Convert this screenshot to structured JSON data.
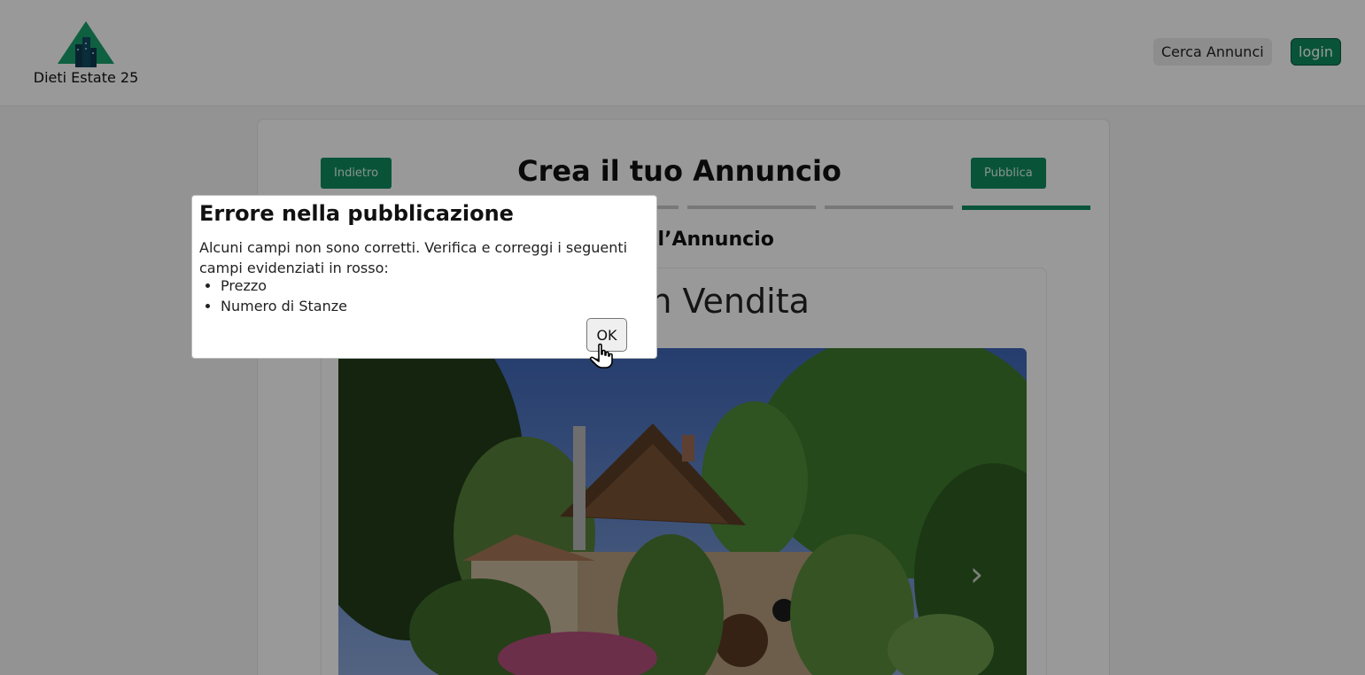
{
  "header": {
    "brand_name": "Dieti Estate 25",
    "logo_icon": "pyramid-buildings-logo",
    "nav_search_label": "Cerca Annunci",
    "nav_login_label": "login",
    "accent_color": "#0f8c5f"
  },
  "form": {
    "back_label": "Indietro",
    "publish_label": "Pubblica",
    "title": "Crea il tuo Annuncio",
    "steps_total": 4,
    "active_step": 4,
    "section_title_visible": "na dell’Annuncio",
    "preview": {
      "listing_title_visible": "ento in Vendita",
      "photo": "stone-cottage-garden-photo",
      "next_icon": "chevron-right-icon",
      "next_glyph": "›"
    }
  },
  "dialog": {
    "title": "Errore nella pubblicazione",
    "message": "Alcuni campi non sono corretti. Verifica e correggi i seguenti campi evidenziati in rosso:",
    "fields": [
      "Prezzo",
      "Numero di Stanze"
    ],
    "ok_label": "OK"
  },
  "cursor_icon": "hand-pointer-icon"
}
